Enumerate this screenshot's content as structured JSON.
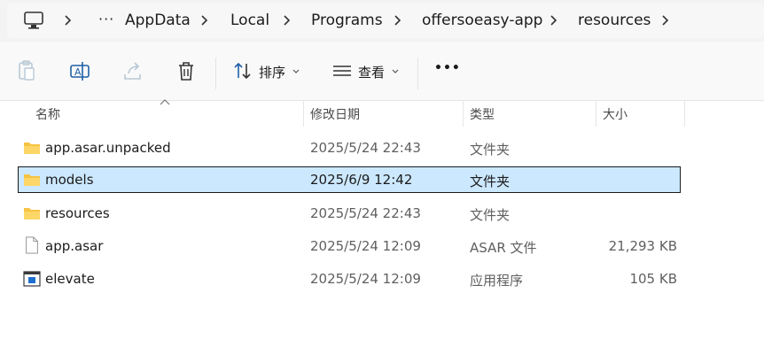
{
  "breadcrumb": {
    "items": [
      "AppData",
      "Local",
      "Programs",
      "offersoeasy-app",
      "resources"
    ]
  },
  "toolbar": {
    "sort_label": "排序",
    "view_label": "查看",
    "more_label": "•••"
  },
  "columns": {
    "name": "名称",
    "modified": "修改日期",
    "type": "类型",
    "size": "大小"
  },
  "files": [
    {
      "name": "app.asar.unpacked",
      "modified": "2025/5/24 22:43",
      "type": "文件夹",
      "size": "",
      "icon": "folder-icon"
    },
    {
      "name": "models",
      "modified": "2025/6/9 12:42",
      "type": "文件夹",
      "size": "",
      "icon": "folder-icon",
      "selected": true
    },
    {
      "name": "resources",
      "modified": "2025/5/24 22:43",
      "type": "文件夹",
      "size": "",
      "icon": "folder-icon"
    },
    {
      "name": "app.asar",
      "modified": "2025/5/24 12:09",
      "type": "ASAR 文件",
      "size": "21,293 KB",
      "icon": "file-icon"
    },
    {
      "name": "elevate",
      "modified": "2025/5/24 12:09",
      "type": "应用程序",
      "size": "105 KB",
      "icon": "app-icon"
    }
  ],
  "colors": {
    "selection": "#cce8ff",
    "folder": "#f6c343"
  }
}
